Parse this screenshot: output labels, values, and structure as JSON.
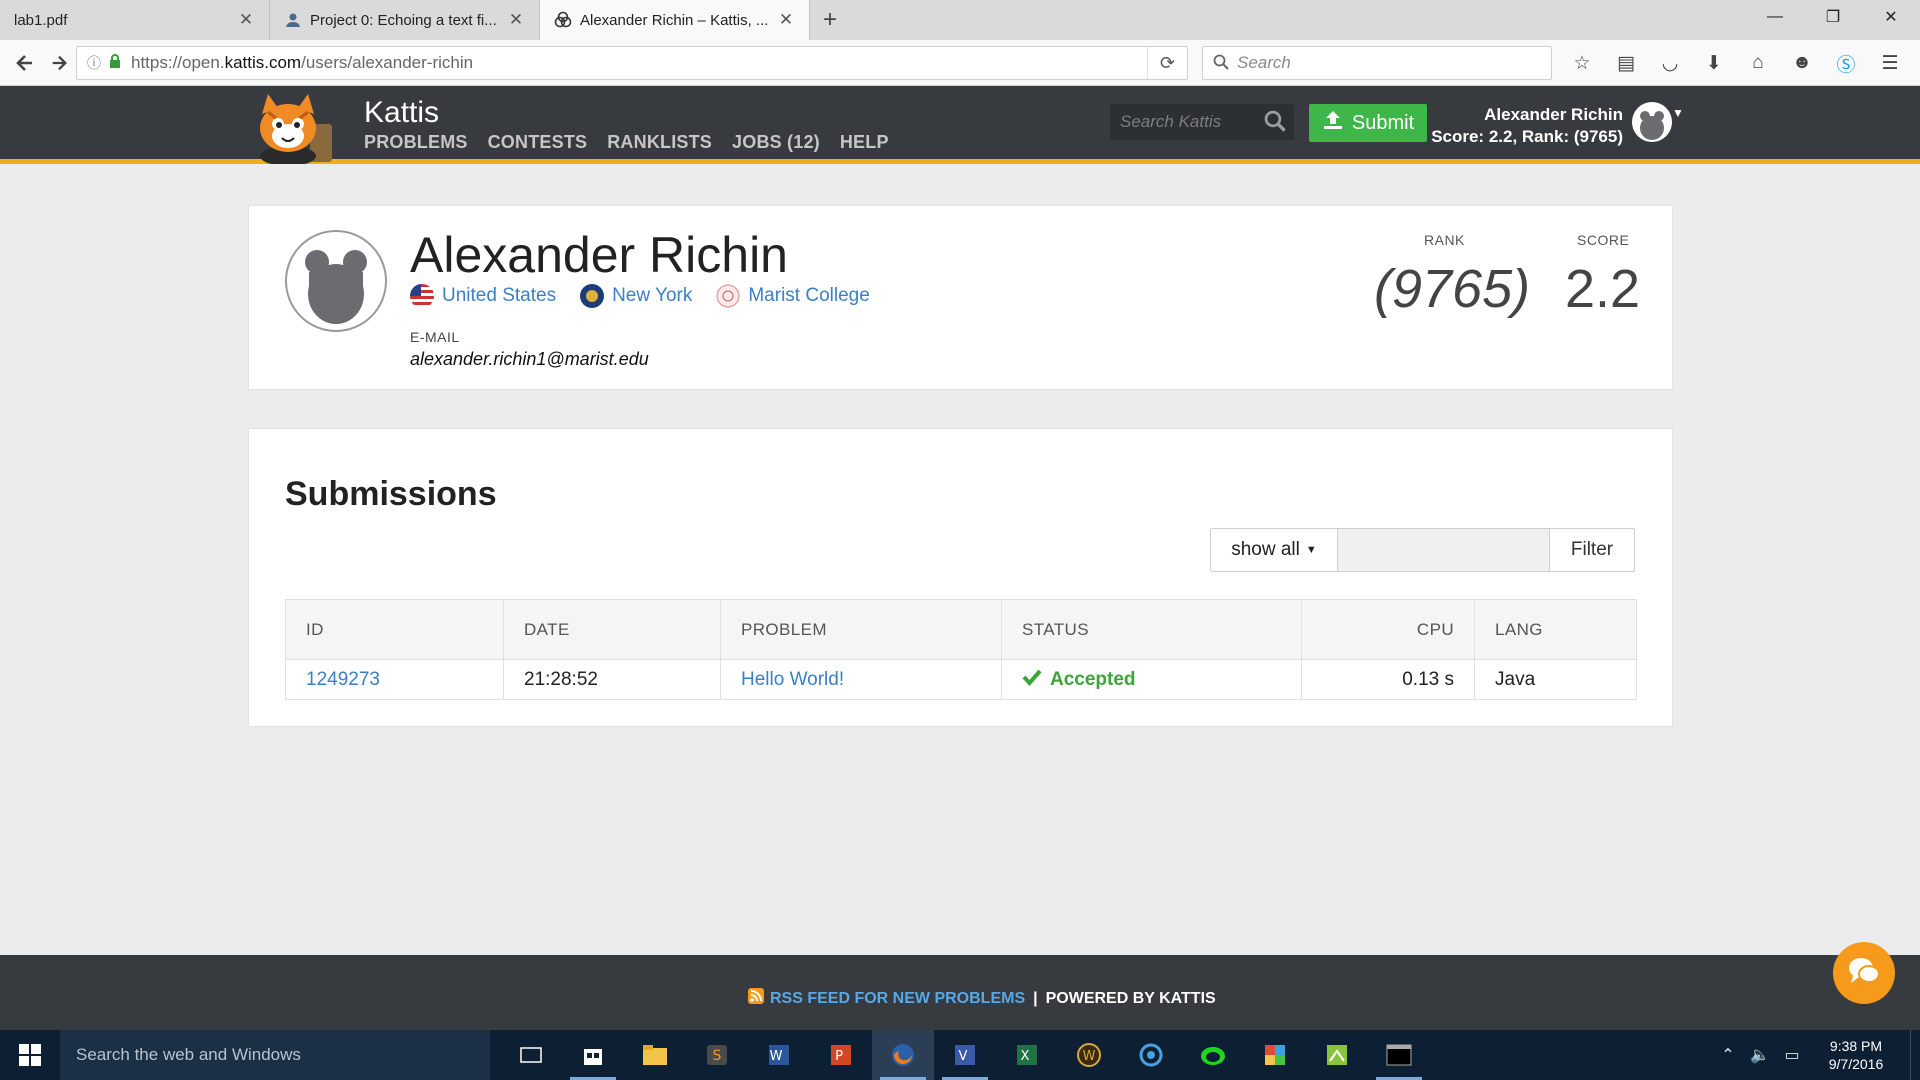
{
  "browser": {
    "tabs": [
      {
        "title": "lab1.pdf",
        "active": false
      },
      {
        "title": "Project 0: Echoing a text fi...",
        "active": false
      },
      {
        "title": "Alexander Richin – Kattis, ...",
        "active": true
      }
    ],
    "url_prefix": "https://open.",
    "url_host": "kattis.com",
    "url_path": "/users/alexander-richin",
    "search_placeholder": "Search"
  },
  "kattis": {
    "brand": "Kattis",
    "menu": [
      "PROBLEMS",
      "CONTESTS",
      "RANKLISTS",
      "JOBS (12)",
      "HELP"
    ],
    "search_placeholder": "Search Kattis",
    "submit_label": "Submit",
    "user_name": "Alexander Richin",
    "user_stats": "Score: 2.2, Rank: (9765)",
    "accent_color": "#f0ad1a",
    "submit_color": "#3fb64a"
  },
  "profile": {
    "name": "Alexander Richin",
    "country": "United States",
    "region": "New York",
    "school": "Marist College",
    "email_label": "E-MAIL",
    "email": "alexander.richin1@marist.edu",
    "rank_label": "RANK",
    "rank_value": "(9765)",
    "score_label": "SCORE",
    "score_value": "2.2"
  },
  "submissions": {
    "title": "Submissions",
    "filter_select": "show all",
    "filter_button": "Filter",
    "columns": [
      "ID",
      "DATE",
      "PROBLEM",
      "STATUS",
      "CPU",
      "LANG"
    ],
    "rows": [
      {
        "id": "1249273",
        "date": "21:28:52",
        "problem": "Hello World!",
        "status": "Accepted",
        "cpu": "0.13 s",
        "lang": "Java"
      }
    ]
  },
  "footer": {
    "rss": "RSS FEED FOR NEW PROBLEMS",
    "separator": "|",
    "powered": "POWERED BY KATTIS"
  },
  "taskbar": {
    "search_placeholder": "Search the web and Windows",
    "time": "9:38 PM",
    "date": "9/7/2016"
  }
}
